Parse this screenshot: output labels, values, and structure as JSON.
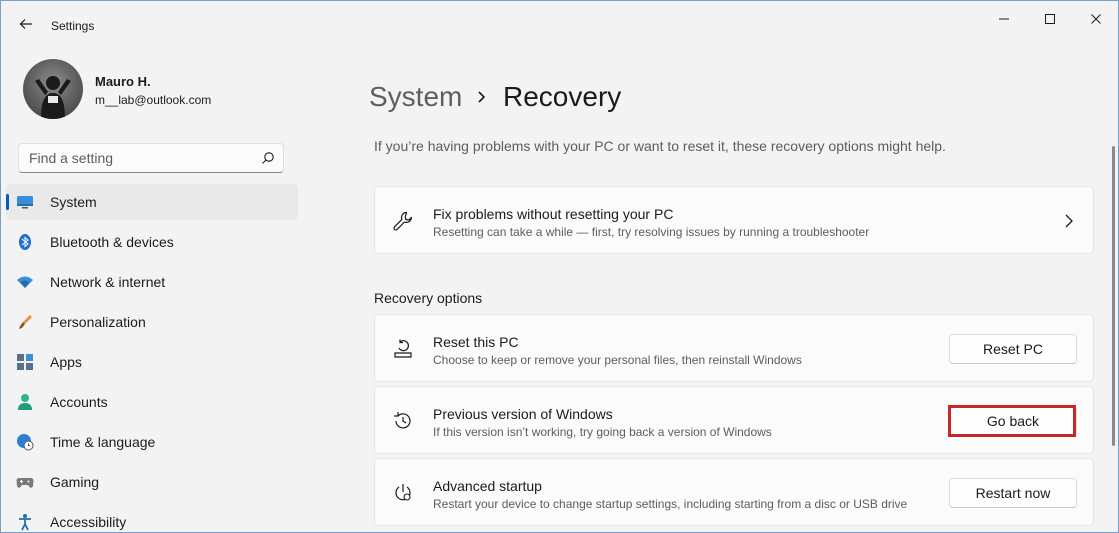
{
  "app": {
    "title": "Settings"
  },
  "user": {
    "name": "Mauro H.",
    "email": "m__lab@outlook.com"
  },
  "search": {
    "placeholder": "Find a setting"
  },
  "nav": {
    "items": [
      {
        "label": "System",
        "icon": "system-icon",
        "active": true
      },
      {
        "label": "Bluetooth & devices",
        "icon": "bluetooth-icon"
      },
      {
        "label": "Network & internet",
        "icon": "wifi-icon"
      },
      {
        "label": "Personalization",
        "icon": "brush-icon"
      },
      {
        "label": "Apps",
        "icon": "apps-icon"
      },
      {
        "label": "Accounts",
        "icon": "person-icon"
      },
      {
        "label": "Time & language",
        "icon": "globe-clock-icon"
      },
      {
        "label": "Gaming",
        "icon": "gamepad-icon"
      },
      {
        "label": "Accessibility",
        "icon": "accessibility-icon"
      }
    ]
  },
  "breadcrumb": {
    "parent": "System",
    "current": "Recovery"
  },
  "main": {
    "description": "If you’re having problems with your PC or want to reset it, these recovery options might help.",
    "fix": {
      "title": "Fix problems without resetting your PC",
      "subtitle": "Resetting can take a while — first, try resolving issues by running a troubleshooter"
    },
    "section_title": "Recovery options",
    "options": [
      {
        "title": "Reset this PC",
        "subtitle": "Choose to keep or remove your personal files, then reinstall Windows",
        "button": "Reset PC",
        "icon": "reset-pc-icon"
      },
      {
        "title": "Previous version of Windows",
        "subtitle": "If this version isn’t working, try going back a version of Windows",
        "button": "Go back",
        "icon": "history-icon",
        "highlighted": true
      },
      {
        "title": "Advanced startup",
        "subtitle": "Restart your device to change startup settings, including starting from a disc or USB drive",
        "button": "Restart now",
        "icon": "advanced-startup-icon"
      }
    ]
  },
  "colors": {
    "accent": "#005fb8",
    "highlight": "#c62828"
  }
}
